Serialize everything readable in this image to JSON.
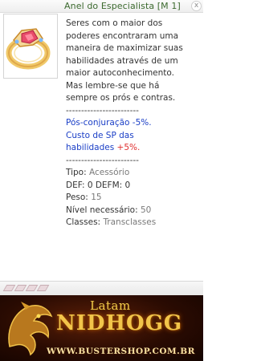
{
  "window": {
    "title": "Anel do Especialista [M 1]",
    "close_symbol": "x",
    "close_icon": "close-icon"
  },
  "item": {
    "icon": "ring-icon",
    "description_lines": [
      "Seres com o maior dos",
      "poderes encontraram uma",
      "maneira de maximizar suas",
      "habilidades através de um",
      "maior autoconhecimento.",
      "Mas lembre-se que há",
      "sempre os prós e contras."
    ],
    "separator": "------------------------",
    "effects": {
      "line1": "Pós-conjuração -5%.",
      "line2": "Custo de SP das",
      "line3_a": "habilidades ",
      "line3_b": "+5%."
    },
    "stats": {
      "tipo_label": "Tipo: ",
      "tipo_value": "Acessório",
      "def_line": "DEF: 0 DEFM: 0",
      "peso_label": "Peso: ",
      "peso_value": "15",
      "nivel_label": "Nível necessário: ",
      "nivel_value": "50",
      "classes_label": "Classes: ",
      "classes_value": "Transclasses"
    }
  },
  "banner": {
    "line1": "Latam",
    "line2": "NIDHOGG",
    "url": "WWW.BUSTERSHOP.COM.BR",
    "icon": "dragon-icon"
  },
  "colors": {
    "title": "#3c6a2f",
    "effect_blue": "#1a3ec6",
    "effect_red": "#e03030",
    "banner_gold": "#f2c54a"
  }
}
